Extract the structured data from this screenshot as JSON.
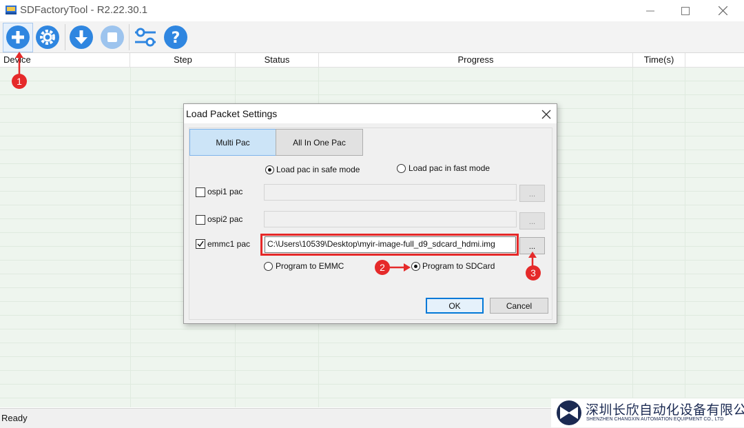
{
  "window": {
    "title": "SDFactoryTool - R2.22.30.1",
    "controls": [
      "minimize",
      "maximize",
      "close"
    ]
  },
  "toolbar": {
    "buttons": [
      {
        "icon": "add-icon",
        "color": "#2f86e0"
      },
      {
        "icon": "settings-icon",
        "color": "#2f86e0"
      },
      {
        "icon": "download-icon",
        "color": "#2f86e0"
      },
      {
        "icon": "stop-icon",
        "color": "#9dc4ee"
      },
      {
        "icon": "sliders-icon",
        "color": "#2f86e0"
      },
      {
        "icon": "help-icon",
        "color": "#2f86e0"
      }
    ]
  },
  "grid": {
    "columns": [
      "Device",
      "Step",
      "Status",
      "Progress",
      "Time(s)"
    ]
  },
  "status_bar": {
    "text": "Ready"
  },
  "dialog": {
    "title": "Load Packet Settings",
    "tabs": [
      "Multi Pac",
      "All In One Pac"
    ],
    "selected_tab": "Multi Pac",
    "load_mode": {
      "safe": "Load pac in safe mode",
      "fast": "Load pac in fast mode",
      "selected": "safe"
    },
    "rows": [
      {
        "label": "ospi1 pac",
        "checked": false,
        "path": "",
        "browse": "..."
      },
      {
        "label": "ospi2 pac",
        "checked": false,
        "path": "",
        "browse": "..."
      },
      {
        "label": "emmc1 pac",
        "checked": true,
        "path": "C:\\Users\\10539\\Desktop\\myir-image-full_d9_sdcard_hdmi.img",
        "browse": "..."
      }
    ],
    "program_target": {
      "emmc": "Program to EMMC",
      "sdcard": "Program to SDCard",
      "selected": "sdcard"
    },
    "ok_label": "OK",
    "cancel_label": "Cancel"
  },
  "annotations": {
    "markers": [
      "1",
      "2",
      "3"
    ],
    "color": "#e52a2a"
  },
  "logo": {
    "cn": "深圳长欣自动化设备有限公司",
    "en": "SHENZHEN CHANGXIN AUTOMATION EQUIPMENT CO., LTD"
  }
}
